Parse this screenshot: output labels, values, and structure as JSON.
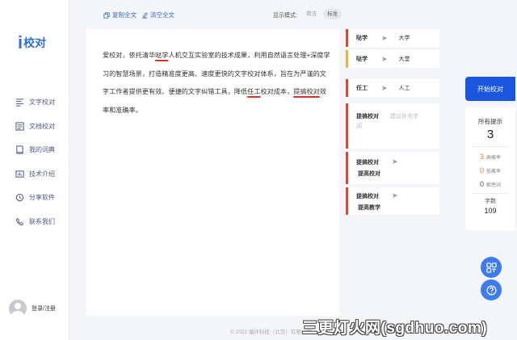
{
  "app": {
    "logo_mark": "i",
    "logo_text": "校对"
  },
  "sidebar": {
    "items": [
      {
        "label": "文字校对",
        "icon": "text-proofread-icon"
      },
      {
        "label": "文档校对",
        "icon": "document-proofread-icon"
      },
      {
        "label": "我的词典",
        "icon": "dictionary-icon"
      },
      {
        "label": "技术介绍",
        "icon": "tech-intro-icon"
      },
      {
        "label": "分享软件",
        "icon": "share-icon"
      },
      {
        "label": "联系我们",
        "icon": "contact-icon"
      }
    ],
    "login_label": "登录/注册"
  },
  "toolbar": {
    "copy_label": "复制全文",
    "clear_label": "清空全文",
    "mode_label": "显示模式:",
    "modes": [
      {
        "label": "简洁",
        "active": false
      },
      {
        "label": "标准",
        "active": true
      }
    ]
  },
  "editor": {
    "segments": [
      {
        "text": "爱校对，依托清华",
        "err": false
      },
      {
        "text": "哒学",
        "err": true
      },
      {
        "text": "人机交互实验室的技术成果，利用自然语言处理+深度学习的智慧场景，打造精准度更高、速度更快的文字校对体系，旨在为严谨的文字工作者提供更有效、便捷的文字纠错工具，降低",
        "err": false
      },
      {
        "text": "任工",
        "err": true
      },
      {
        "text": "校对成本，",
        "err": false
      },
      {
        "text": "提搞校对",
        "err": true
      },
      {
        "text": "效率和准确率。",
        "err": false
      }
    ]
  },
  "suggestions": {
    "c1": {
      "word": "哒学",
      "replacement": "大学"
    },
    "c2": {
      "word": "哒学",
      "replacement": "大堂"
    },
    "c3": {
      "word": "任工",
      "replacement": "人工"
    },
    "c4": {
      "word": "提搞校对",
      "hint_line1": "建议补充字",
      "hint_line2": "词"
    },
    "c5": {
      "word_line1": "提搞校对",
      "word_line2": "提高校对"
    },
    "c6": {
      "word_line1": "提搞校对",
      "word_line2": "提高教学"
    },
    "colors": {
      "high": "#d44a2e",
      "medium": "#e8b43a"
    }
  },
  "panel": {
    "start_label": "开始校对",
    "total_label": "所有提示",
    "total": "3",
    "high": {
      "value": "3",
      "label": "高概率",
      "color": "#e6782a"
    },
    "medium": {
      "value": "0",
      "label": "低概率",
      "color": "#e6782a"
    },
    "low": {
      "value": "0",
      "label": "敏感词",
      "color": "#555555"
    },
    "word_count_label": "字数",
    "word_count": "109"
  },
  "footer": {
    "text": "© 2022 循环科技（北京）有限公司"
  },
  "watermark": {
    "text": "三更灯火网(sgdhuo.com)"
  },
  "colors": {
    "accent": "#1a57de",
    "link": "#3a6cc8",
    "error": "#d7322c"
  }
}
